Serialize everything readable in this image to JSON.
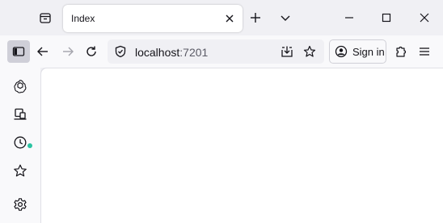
{
  "tab": {
    "title": "Index"
  },
  "urlbar": {
    "host": "localhost",
    "port": ":7201"
  },
  "account": {
    "signin_label": "Sign in"
  },
  "icons": {
    "tabstrip": "firefox-view-icon",
    "tab_close": "close-icon",
    "new_tab": "plus-icon",
    "list_tabs": "chevron-down-icon",
    "minimize": "minimize-icon",
    "maximize": "maximize-icon",
    "close": "close-icon",
    "sidebar": "sidebar-icon",
    "back": "arrow-left-icon",
    "forward": "arrow-right-icon",
    "reload": "reload-icon",
    "security": "shield-icon",
    "save_page": "download-icon",
    "bookmark": "star-icon",
    "account": "account-icon",
    "extensions": "puzzle-icon",
    "menu": "hamburger-icon",
    "ai": "ai-chatbot-icon",
    "synced_tabs": "synced-tabs-icon",
    "history": "clock-icon",
    "bookmarks": "star-icon",
    "settings": "gear-icon"
  },
  "colors": {
    "status_dot": "#2ac3a2",
    "icon": "#15141a",
    "disabled_icon": "#a3a3ab",
    "sidebar_active_bg": "#cfcfd8"
  }
}
